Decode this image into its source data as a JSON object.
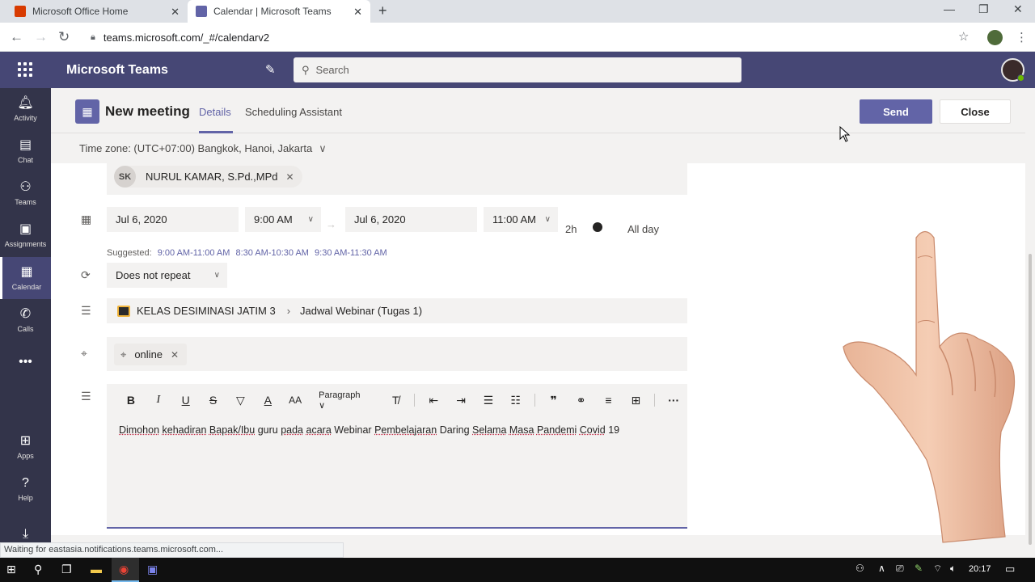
{
  "browser": {
    "tabs": [
      {
        "title": "Microsoft Office Home"
      },
      {
        "title": "Calendar | Microsoft Teams"
      }
    ],
    "url": "teams.microsoft.com/_#/calendarv2",
    "status_text": "Waiting for eastasia.notifications.teams.microsoft.com..."
  },
  "teams": {
    "app_name": "Microsoft Teams",
    "search_placeholder": "Search"
  },
  "appbar": {
    "activity": "Activity",
    "chat": "Chat",
    "teams": "Teams",
    "assignments": "Assignments",
    "calendar": "Calendar",
    "calls": "Calls",
    "more": "•••",
    "apps": "Apps",
    "help": "Help"
  },
  "meeting": {
    "title": "New meeting",
    "tab_details": "Details",
    "tab_scheduling": "Scheduling Assistant",
    "send_label": "Send",
    "close_label": "Close",
    "timezone": "Time zone: (UTC+07:00) Bangkok, Hanoi, Jakarta",
    "attendee": {
      "initials": "SK",
      "name": "NURUL KAMAR, S.Pd.,MPd"
    },
    "start_date": "Jul 6, 2020",
    "start_time": "9:00 AM",
    "end_date": "Jul 6, 2020",
    "end_time": "11:00 AM",
    "duration": "2h",
    "all_day_label": "All day",
    "suggested_label": "Suggested:",
    "suggestions": [
      "9:00 AM-11:00 AM",
      "8:30 AM-10:30 AM",
      "9:30 AM-11:30 AM"
    ],
    "repeat": "Does not repeat",
    "team": "KELAS DESIMINASI JATIM 3",
    "channel": "Jadwal Webinar (Tugas 1)",
    "location": "online",
    "paragraph_label": "Paragraph",
    "body_words": [
      "Dimohon",
      "kehadiran",
      "Bapak/Ibu",
      "guru",
      "pada",
      "acara",
      "Webinar",
      "Pembelajaran",
      "Daring",
      "Selama",
      "Masa",
      "Pandemi",
      "Covid",
      "19"
    ]
  },
  "taskbar": {
    "time": "20:17"
  },
  "colors": {
    "teams_purple": "#6264a7",
    "header_bg": "#464775",
    "appbar_bg": "#33344a"
  }
}
